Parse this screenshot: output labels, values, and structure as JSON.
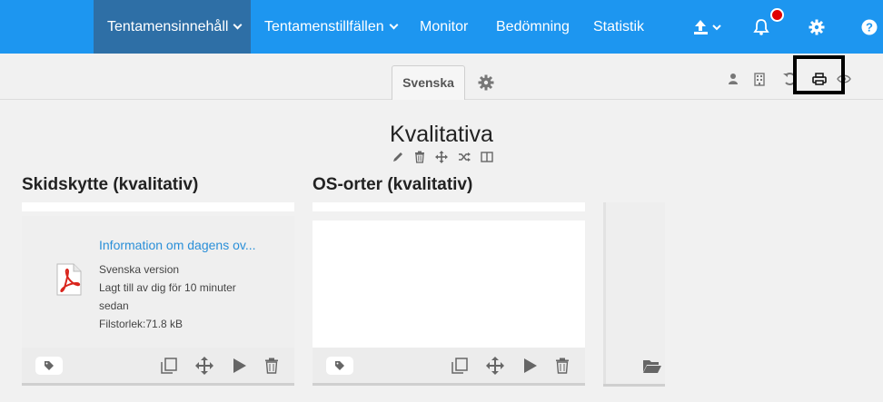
{
  "nav": {
    "items": [
      {
        "label": "Tentamensinnehåll",
        "dropdown": true,
        "active": true
      },
      {
        "label": "Tentamenstillfällen",
        "dropdown": true,
        "active": false
      },
      {
        "label": "Monitor",
        "dropdown": false,
        "active": false
      },
      {
        "label": "Bedömning",
        "dropdown": false,
        "active": false
      },
      {
        "label": "Statistik",
        "dropdown": false,
        "active": false
      }
    ],
    "icons": [
      "upload-icon",
      "bell-icon",
      "gear-icon",
      "help-icon"
    ],
    "accent": "#1d96f0",
    "active_bg": "#2e6fa6",
    "notification_color": "#e00000"
  },
  "toolbar": {
    "language_tab": "Svenska",
    "icons": [
      "settings-icon",
      "user-icon",
      "building-icon",
      "undo-icon",
      "print-icon",
      "eye-icon"
    ]
  },
  "section": {
    "title": "Kvalitativa",
    "actions": [
      "edit-icon",
      "trash-icon",
      "move-icon",
      "shuffle-icon",
      "columns-icon"
    ]
  },
  "columns": [
    {
      "title": "Skidskytte (kvalitativ)",
      "document": {
        "title": "Information om dagens ov...",
        "version": "Svenska version",
        "added": "Lagt till av dig för 10 minuter",
        "added_cont": "sedan",
        "size": "Filstorlek:71.8 kB"
      }
    },
    {
      "title": "OS-orter (kvalitativ)"
    }
  ]
}
